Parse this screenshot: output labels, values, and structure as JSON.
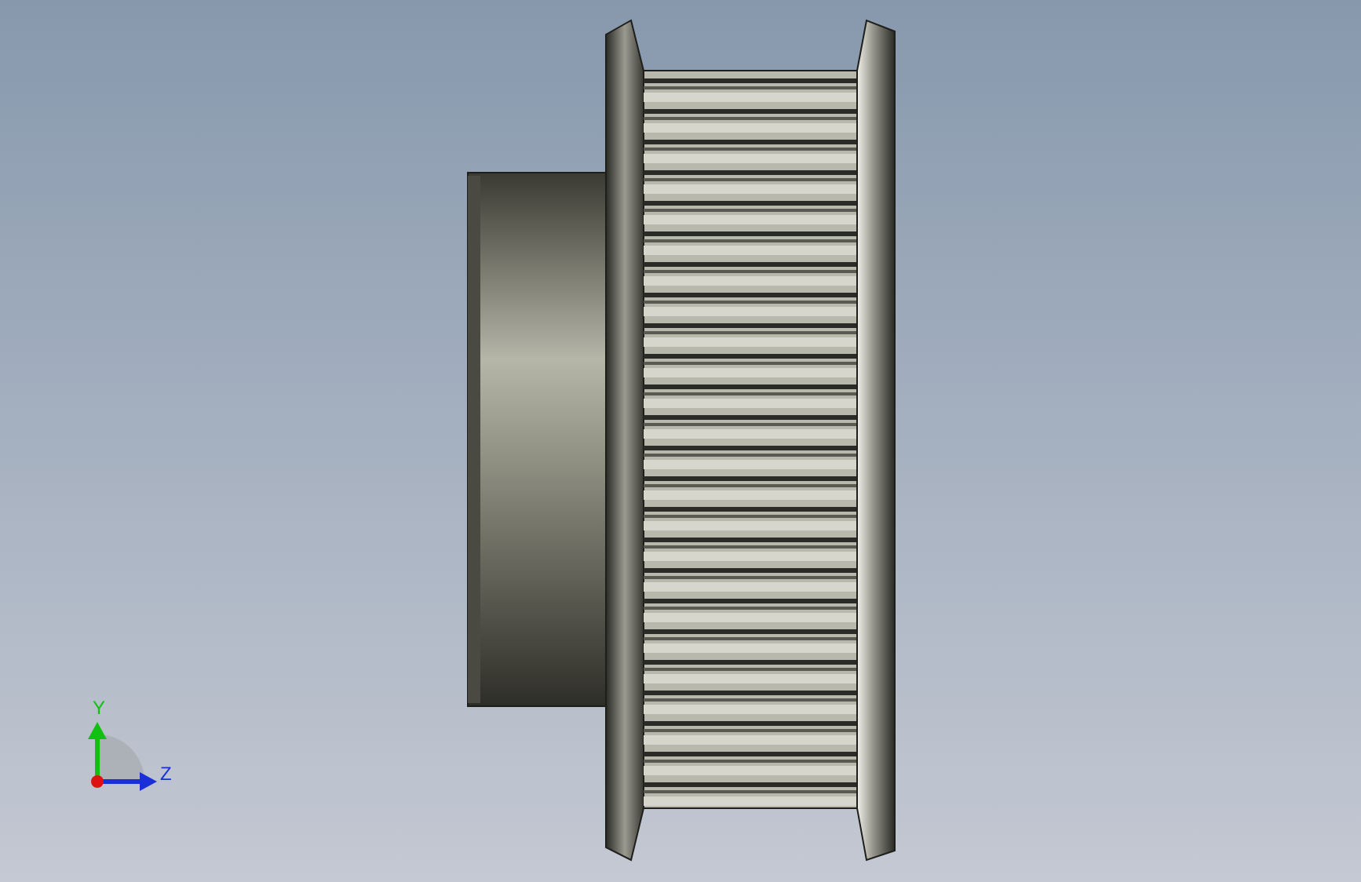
{
  "viewport": {
    "axis_triad": {
      "y_label": "Y",
      "z_label": "Z"
    }
  }
}
